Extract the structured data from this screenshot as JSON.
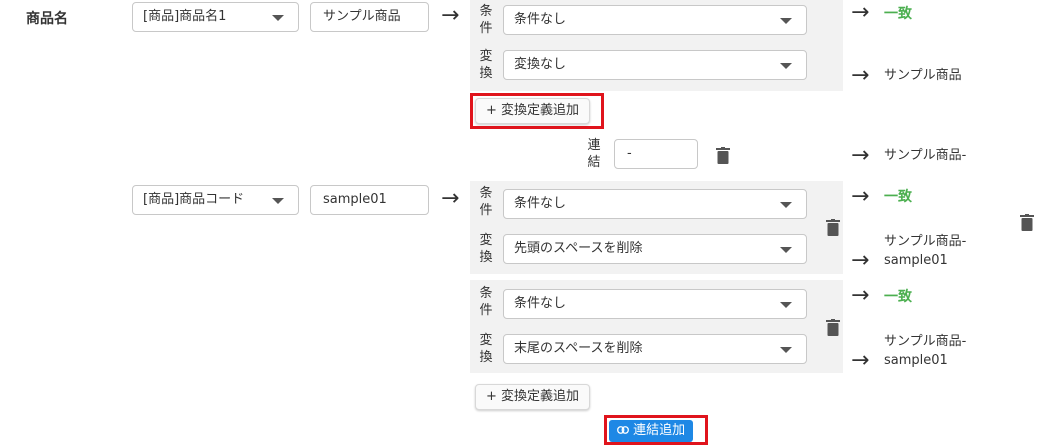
{
  "field": {
    "label": "商品名"
  },
  "row1": {
    "source_select": "[商品]商品名1",
    "sample_value": "サンプル商品",
    "condition_label": [
      "条",
      "件"
    ],
    "condition_value": "条件なし",
    "conversion_label": [
      "変",
      "換"
    ],
    "conversion_value": "変換なし",
    "result_match": "一致",
    "result_text": "サンプル商品",
    "add_conversion": "変換定義追加"
  },
  "join": {
    "label": [
      "連",
      "結"
    ],
    "value": "-",
    "result_text": "サンプル商品-"
  },
  "row2": {
    "source_select": "[商品]商品コード",
    "sample_value": "sample01",
    "block1": {
      "condition_label": [
        "条",
        "件"
      ],
      "condition_value": "条件なし",
      "conversion_label": [
        "変",
        "換"
      ],
      "conversion_value": "先頭のスペースを削除",
      "result_match": "一致",
      "result_line1": "サンプル商品-",
      "result_line2": "sample01"
    },
    "block2": {
      "condition_label": [
        "条",
        "件"
      ],
      "condition_value": "条件なし",
      "conversion_label": [
        "変",
        "換"
      ],
      "conversion_value": "末尾のスペースを削除",
      "result_match": "一致",
      "result_line1": "サンプル商品-",
      "result_line2": "sample01"
    },
    "add_conversion": "変換定義追加"
  },
  "add_join": {
    "label": "連結追加",
    "icon": "link-icon"
  },
  "colors": {
    "accent": "#1e88e5",
    "match": "#4caf50",
    "highlight": "#e0141c",
    "panel": "#f2f2f2"
  },
  "icons": {
    "arrow": "→",
    "plus": "+",
    "trash": "trash-icon"
  }
}
